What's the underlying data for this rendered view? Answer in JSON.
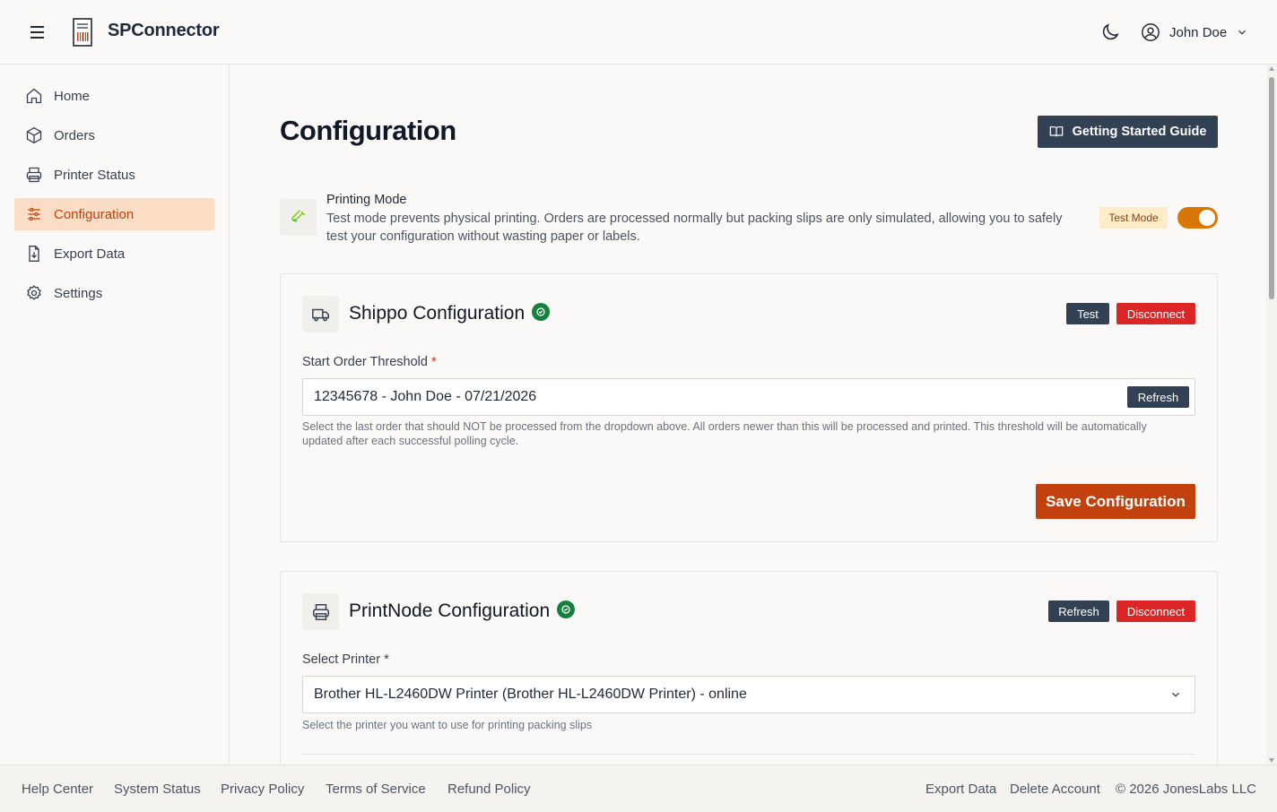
{
  "app": {
    "name": "SPConnector"
  },
  "header": {
    "user_name": "John Doe"
  },
  "sidebar": {
    "items": [
      {
        "label": "Home",
        "icon": "home-icon"
      },
      {
        "label": "Orders",
        "icon": "box-icon"
      },
      {
        "label": "Printer Status",
        "icon": "printer-icon"
      },
      {
        "label": "Configuration",
        "icon": "sliders-icon",
        "active": true
      },
      {
        "label": "Export Data",
        "icon": "file-download-icon"
      },
      {
        "label": "Settings",
        "icon": "gear-icon"
      }
    ]
  },
  "main": {
    "title": "Configuration",
    "guide_button": "Getting Started Guide",
    "printing_mode": {
      "title": "Printing Mode",
      "description": "Test mode prevents physical printing. Orders are processed normally but packing slips are only simulated, allowing you to safely test your configuration without wasting paper or labels.",
      "badge": "Test Mode",
      "toggle_on": true
    },
    "shippo": {
      "title": "Shippo Configuration",
      "test_button": "Test",
      "disconnect_button": "Disconnect",
      "threshold_label": "Start Order Threshold",
      "required_mark": "*",
      "threshold_value": "12345678 - John Doe - 07/21/2026",
      "refresh_button": "Refresh",
      "help": "Select the last order that should NOT be processed from the dropdown above. All orders newer than this will be processed and printed. This threshold will be automatically updated after each successful polling cycle.",
      "save_button": "Save Configuration"
    },
    "printnode": {
      "title": "PrintNode Configuration",
      "refresh_button": "Refresh",
      "disconnect_button": "Disconnect",
      "printer_label": "Select Printer *",
      "printer_value": "Brother HL-L2460DW Printer (Brother HL-L2460DW Printer) - online",
      "help": "Select the printer you want to use for printing packing slips"
    }
  },
  "footer": {
    "links": [
      "Help Center",
      "System Status",
      "Privacy Policy",
      "Terms of Service",
      "Refund Policy"
    ],
    "right_links": [
      "Export Data",
      "Delete Account"
    ],
    "copyright": "© 2026 JonesLabs LLC"
  },
  "colors": {
    "accent": "#c2410c",
    "dark": "#334155",
    "danger": "#dc2626",
    "success": "#15803d"
  }
}
